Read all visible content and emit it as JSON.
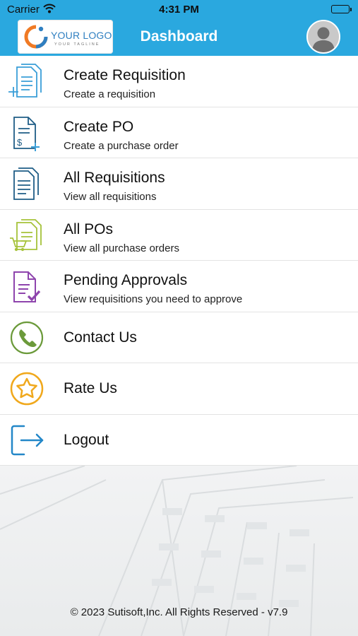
{
  "status_bar": {
    "carrier": "Carrier",
    "time": "4:31 PM"
  },
  "header": {
    "logo_text": "YOUR LOGO",
    "logo_tagline": "YOUR TAGLINE",
    "title": "Dashboard"
  },
  "menu": [
    {
      "title": "Create Requisition",
      "subtitle": "Create a requisition",
      "icon": "create-requisition-icon"
    },
    {
      "title": "Create PO",
      "subtitle": "Create a purchase order",
      "icon": "create-po-icon"
    },
    {
      "title": "All Requisitions",
      "subtitle": "View all requisitions",
      "icon": "all-requisitions-icon"
    },
    {
      "title": "All POs",
      "subtitle": "View all purchase orders",
      "icon": "all-pos-icon"
    },
    {
      "title": "Pending Approvals",
      "subtitle": "View requisitions you need to approve",
      "icon": "pending-approvals-icon"
    },
    {
      "title": "Contact Us",
      "icon": "phone-icon"
    },
    {
      "title": "Rate Us",
      "icon": "star-icon"
    },
    {
      "title": "Logout",
      "icon": "logout-icon"
    }
  ],
  "footer": {
    "copyright": "© 2023 Sutisoft,Inc. All Rights Reserved - v7.9"
  },
  "colors": {
    "header_bg": "#2aa8df",
    "requisition_blue": "#3a9fd8",
    "po_navy": "#1f5d86",
    "all_pos_green": "#a6c23a",
    "approvals_purple": "#8e44ad",
    "contact_green": "#6b9a3a",
    "rate_orange": "#f0a81c",
    "logout_blue": "#2387c8"
  }
}
